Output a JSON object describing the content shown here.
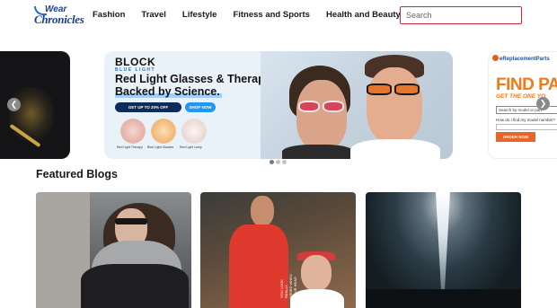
{
  "header": {
    "logo_top": "Wear",
    "logo_bottom": "Chronicles",
    "nav": [
      "Fashion",
      "Travel",
      "Lifestyle",
      "Fitness and Sports",
      "Health and Beauty"
    ],
    "search_placeholder": "Search"
  },
  "carousel": {
    "prev_icon": "chevron-left-icon",
    "next_icon": "chevron-right-icon",
    "main_slide": {
      "brand": "BLOCK",
      "brand_sub": "BLUE LIGHT",
      "headline_line1": "Red Light Glasses & Therapy",
      "headline_line2": "Backed by Science.",
      "cta_primary": "GET UP TO 20% OFF",
      "cta_secondary": "SHOP NOW",
      "products": [
        "Red Light Therapy",
        "Blue Light Glasses",
        "Red Light Lamp"
      ]
    },
    "right_slide": {
      "brand": "eReplacementParts",
      "headline": "FIND PA",
      "subhead": "GET THE ONE YO",
      "search_placeholder": "Search by model or part",
      "help_link": "How do I find my model number?",
      "button": "ORDER NOW"
    },
    "dots": 3,
    "active_dot": 0
  },
  "featured": {
    "title": "Featured Blogs",
    "cards": [
      {
        "image": "woman-sunglasses-hoodie"
      },
      {
        "image": "man-red-tshirt-festival"
      },
      {
        "image": "light-beam-night"
      }
    ],
    "card2_shirt_text": "YOU LOOK REALLY WEIRD WHEN YOUR HEAD"
  },
  "colors": {
    "accent": "#d0263a",
    "logo": "#1d3f8a",
    "cta_dark": "#0c2c5c",
    "cta_blue": "#2196f3",
    "rp_orange": "#f07a18"
  }
}
